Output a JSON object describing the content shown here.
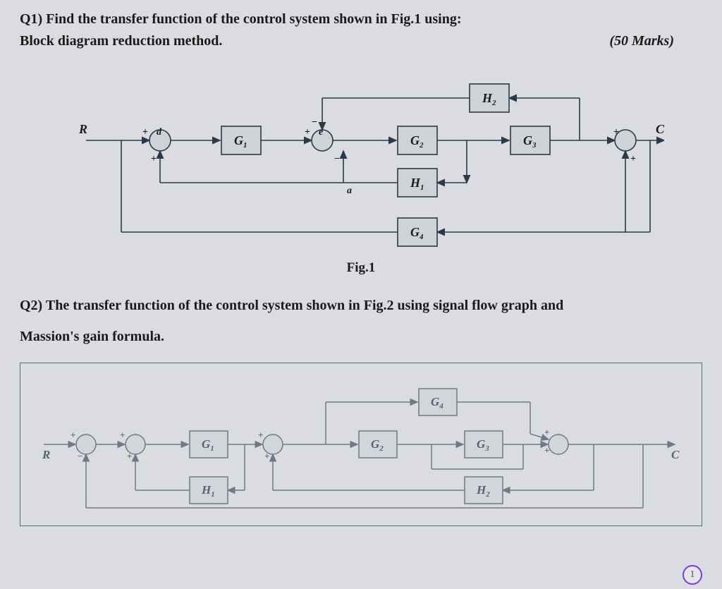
{
  "q1": {
    "prefix": "Q1)",
    "line1": "Find the transfer function of the control system shown in Fig.1 using:",
    "line2": "Block diagram reduction method.",
    "marks": "(50 Marks)"
  },
  "fig1": {
    "label": "Fig.1",
    "input": "R",
    "output": "C",
    "sum_d": "d",
    "sum_e": "e",
    "sum_a": "a",
    "blocks": {
      "G1": "G",
      "G1_sub": "1",
      "G2": "G",
      "G2_sub": "2",
      "G3": "G",
      "G3_sub": "3",
      "G4": "G",
      "G4_sub": "4",
      "H1": "H",
      "H1_sub": "1",
      "H2": "H",
      "H2_sub": "2"
    },
    "signs": {
      "plus": "+",
      "minus": "−"
    }
  },
  "q2": {
    "prefix": "Q2)",
    "line1": "The transfer function of the control system shown in Fig.2 using signal flow graph and",
    "line2": "Massion's gain formula."
  },
  "fig2": {
    "input": "R",
    "output": "C",
    "blocks": {
      "G1": "G",
      "G1_sub": "1",
      "G2": "G",
      "G2_sub": "2",
      "G3": "G",
      "G3_sub": "3",
      "G4": "G",
      "G4_sub": "4",
      "H1": "H",
      "H1_sub": "1",
      "H2": "H",
      "H2_sub": "2"
    },
    "signs": {
      "plus": "+",
      "minus": "−"
    }
  },
  "page": "1"
}
